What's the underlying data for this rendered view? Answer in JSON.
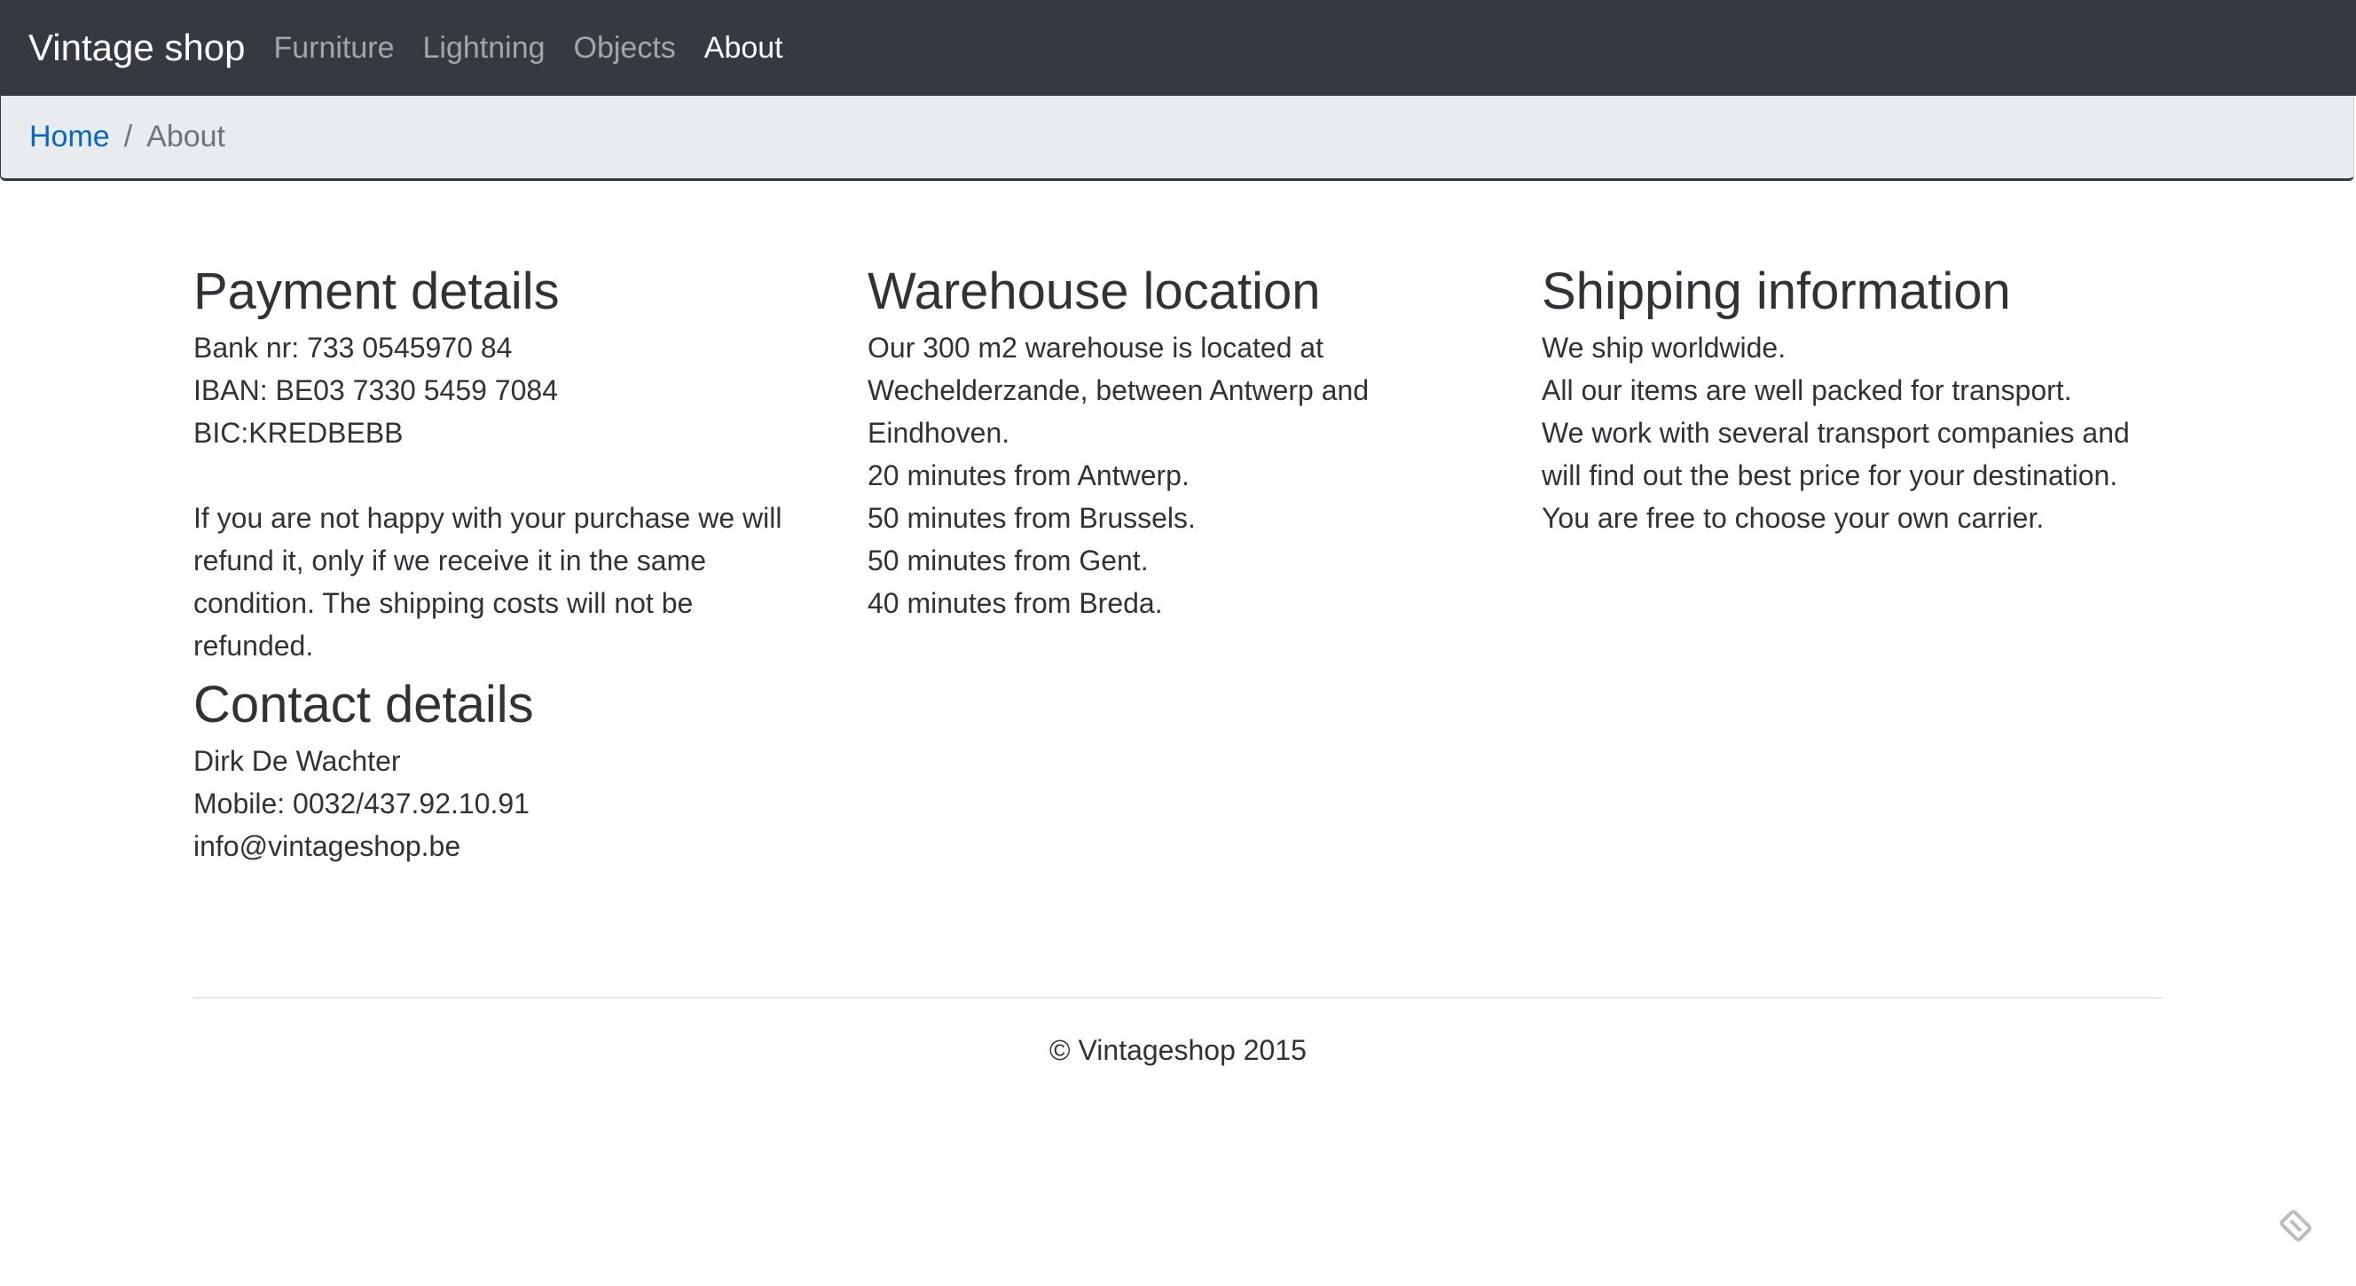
{
  "navbar": {
    "brand": "Vintage shop",
    "links": [
      {
        "label": "Furniture",
        "active": false
      },
      {
        "label": "Lightning",
        "active": false
      },
      {
        "label": "Objects",
        "active": false
      },
      {
        "label": "About",
        "active": true
      }
    ]
  },
  "breadcrumb": {
    "home": "Home",
    "separator": "/",
    "current": "About"
  },
  "payment": {
    "title": "Payment details",
    "lines": [
      "Bank nr: 733 0545970 84",
      "IBAN: BE03 7330 5459 7084",
      "BIC:KREDBEBB"
    ],
    "refund_text": "If you are not happy with your purchase we will refund it, only if we receive it in the same condition. The shipping costs will not be refunded."
  },
  "contact": {
    "title": "Contact details",
    "lines": [
      "Dirk De Wachter",
      "Mobile: 0032/437.92.10.91",
      "info@vintageshop.be"
    ]
  },
  "warehouse": {
    "title": "Warehouse location",
    "intro": "Our 300 m2 warehouse is located at Wechelderzande, between Antwerp and Eindhoven.",
    "lines": [
      "20 minutes from Antwerp.",
      "50 minutes from Brussels.",
      "50 minutes from Gent.",
      "40 minutes from Breda."
    ]
  },
  "shipping": {
    "title": "Shipping information",
    "lines": [
      "We ship worldwide.",
      "All our items are well packed for transport."
    ],
    "text": "We work with several transport companies and will find out the best price for your destination.",
    "last_line": "You are free to choose your own carrier."
  },
  "footer": {
    "copyright": "© Vintageshop 2015"
  },
  "icons": {
    "corner": "pen-edit-icon"
  },
  "colors": {
    "navbar_bg": "#343a40",
    "breadcrumb_bg": "#e9ecef",
    "link": "#0a66c2"
  }
}
